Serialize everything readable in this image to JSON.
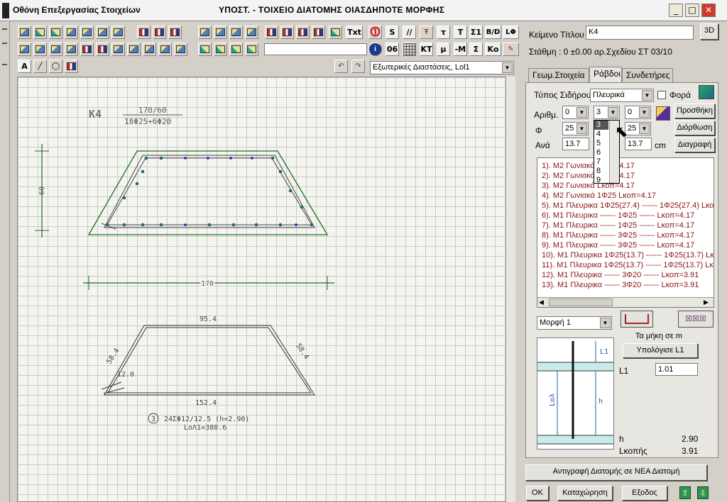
{
  "window": {
    "title": "Οθόνη Επεξεργασίας Στοιχείων",
    "subtitle": "ΥΠΟΣΤ. - ΤΟΙΧΕΙΟ  ΔΙΑΤΟΜΗΣ ΟΙΑΣΔΗΠΟΤΕ ΜΟΡΦΗΣ",
    "min": "_",
    "max": "□",
    "close": "✕"
  },
  "toolbar": {
    "txt_btn": "Txt",
    "info_sym": "i",
    "row1_right": [
      "S",
      "//",
      "τ",
      "T",
      "Σ1",
      "B/D",
      "LΦ"
    ],
    "row2_right": [
      "06",
      "KT",
      "μ",
      "-M",
      "Σ",
      "Ko"
    ],
    "view_select": "Εξωτερικές Διαστάσεις, Lol1",
    "text_tool": "A"
  },
  "drawing": {
    "section_name": "K4",
    "dims": "170/60",
    "rebar": "18Φ25+6Φ20",
    "height": "60",
    "width": "170",
    "shape_top": "95.4",
    "shape_left": "58.4",
    "shape_right": "58.4",
    "shape_hook": "12.0",
    "shape_bottom": "152.4",
    "stirrup_num": "3",
    "stirrup_desc": "24ΣΦ12/12.5 (h=2.90)",
    "stirrup_len": "LoΛ1=388.6"
  },
  "right": {
    "title_label": "Κείμενο Τίτλου",
    "title_value": "K4",
    "btn_3d": "3D",
    "levels": "Στάθμη : 0  ±0.00  αρ.Σχεδίου ΣΤ 03/10",
    "tabs": [
      "Γεωμ.Στοιχεία",
      "Ράβδοι",
      "Συνδετήρες"
    ],
    "steel_type_label": "Τύπος Σιδήρου",
    "steel_type": "Πλευρικά",
    "fora_label": "Φορά",
    "num_label": "Αριθμ.",
    "num_values": [
      "0",
      "3",
      "0"
    ],
    "phi_label": "Φ",
    "phi_values": [
      "25",
      "25"
    ],
    "ana_label": "Ανά",
    "ana_values": [
      "13.7",
      "13.7"
    ],
    "cm": "cm",
    "dropdown": [
      "3",
      "4",
      "5",
      "6",
      "7",
      "8",
      "9"
    ],
    "btn_add": "Προσθήκη",
    "btn_fix": "Διόρθωση",
    "btn_del": "Διαγραφή",
    "rows": [
      "1). M2 Γωνιακά          Lκοπ=4.17",
      "2). M2 Γωνιακά          Lκοπ=4.17",
      "3). M2 Γωνιακά          Lκοπ=4.17",
      "4). M2 Γωνιακά 1Φ25 Lκοπ=4.17",
      "5). M1 Πλευρικα 1Φ25(27.4) ------ 1Φ25(27.4)  Lκο",
      "6). M1 Πλευρικα ------ 1Φ25 ------  Lκοπ=4.17",
      "7). M1 Πλευρικα ------ 1Φ25 ------  Lκοπ=4.17",
      "8). M1 Πλευρικα ------ 3Φ25 ------  Lκοπ=4.17",
      "9). M1 Πλευρικα ------ 3Φ25 ------  Lκοπ=4.17",
      "10). M1 Πλευρικα 1Φ25(13.7) ------ 1Φ25(13.7)  Lκο",
      "11). M1 Πλευρικα 1Φ25(13.7) ------ 1Φ25(13.7)  Lκο",
      "12). M1 Πλευρικα ------ 3Φ20 ------  Lκοπ=3.91",
      "13). M1 Πλευρικα ------ 3Φ20 ------  Lκοπ=3.91"
    ],
    "form_select": "Μορφή 1",
    "lengths_label": "Τα μήκη σε m",
    "calc_btn": "Υπολόγισε L1",
    "l1_label": "L1",
    "l1_value": "1.01",
    "diag_l1": "L1",
    "diag_lol": "Loλ",
    "diag_h": "h",
    "h_label": "h",
    "h_value": "2.90",
    "lkop_label": "Lκοπής",
    "lkop_value": "3.91",
    "copy_btn": "Αντιγραφή Διατομής σε ΝΕΑ Διατομή",
    "ok": "OK",
    "save": "Καταχώρηση",
    "exit": "Εξοδος"
  }
}
